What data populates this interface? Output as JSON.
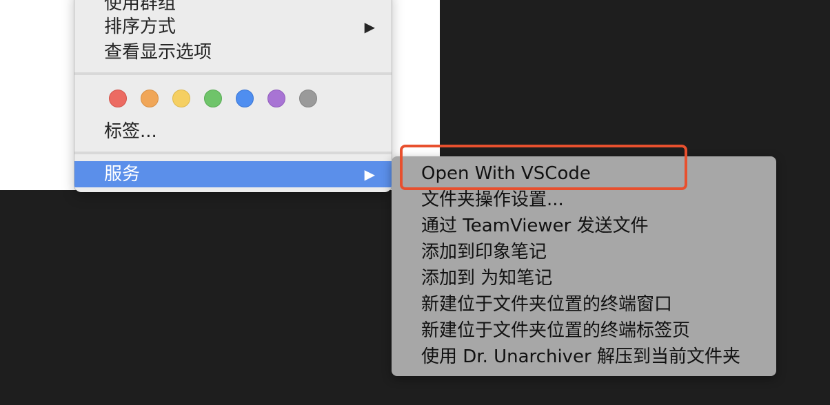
{
  "context_menu": {
    "items_top": [
      {
        "label": "使用群组",
        "has_submenu": false
      },
      {
        "label": "排序方式",
        "has_submenu": true
      },
      {
        "label": "查看显示选项",
        "has_submenu": false
      }
    ],
    "tag_colors": [
      {
        "name": "red",
        "color": "#ec6b62"
      },
      {
        "name": "orange",
        "color": "#f0a658"
      },
      {
        "name": "yellow",
        "color": "#f5cf62"
      },
      {
        "name": "green",
        "color": "#6fc46a"
      },
      {
        "name": "blue",
        "color": "#4f8ef0"
      },
      {
        "name": "purple",
        "color": "#a874d4"
      },
      {
        "name": "gray",
        "color": "#9a9a9a"
      }
    ],
    "tags_label": "标签...",
    "services_label": "服务",
    "submenu_arrow": "▶",
    "highlight_color": "#5b8fea"
  },
  "services_submenu": {
    "items": [
      {
        "label": "Open With VSCode"
      },
      {
        "label": "文件夹操作设置..."
      },
      {
        "label": "通过 TeamViewer 发送文件"
      },
      {
        "label": "添加到印象笔记"
      },
      {
        "label": "添加到 为知笔记"
      },
      {
        "label": "新建位于文件夹位置的终端窗口"
      },
      {
        "label": "新建位于文件夹位置的终端标签页"
      },
      {
        "label": "使用 Dr. Unarchiver 解压到当前文件夹"
      }
    ],
    "annotation_color": "#e8502e"
  }
}
